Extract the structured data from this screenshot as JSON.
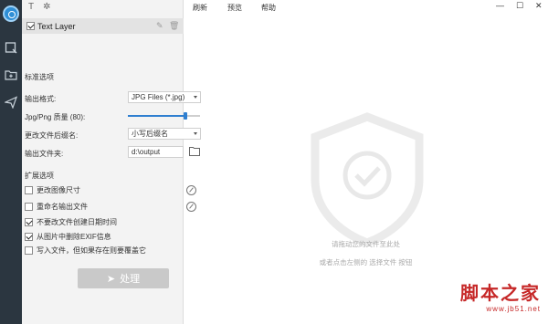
{
  "sidebar": {
    "icons": [
      "app-logo-icon",
      "crop-icon",
      "add-folder-icon",
      "send-icon"
    ]
  },
  "left_panel": {
    "toolbar_icons": [
      "text-tool-icon",
      "settings-icon"
    ],
    "layer": {
      "checked": true,
      "name": "Text Layer"
    },
    "standard_section": "标准选项",
    "output_format_label": "输出格式:",
    "output_format_value": "JPG Files (*.jpg)",
    "quality_label": "Jpg/Png 质量 (80):",
    "quality_value": 80,
    "rename_label": "更改文件后缀名:",
    "rename_value": "小写后缀名",
    "output_folder_label": "输出文件夹:",
    "output_folder_value": "d:\\output",
    "extended_section": "扩展选项",
    "options": [
      {
        "label": "更改图像尺寸",
        "checked": false,
        "has_settings": true
      },
      {
        "label": "重命名输出文件",
        "checked": false,
        "has_settings": true
      },
      {
        "label": "不要改文件创建日期时间",
        "checked": true,
        "has_settings": false
      },
      {
        "label": "从图片中删除EXIF信息",
        "checked": true,
        "has_settings": false
      },
      {
        "label": "写入文件，但如果存在则要覆盖它",
        "checked": false,
        "has_settings": false
      }
    ],
    "process_button": "处理"
  },
  "menu": {
    "refresh": "刷新",
    "preview": "预览",
    "help": "帮助"
  },
  "window_controls": {
    "minimize": "—",
    "maximize": "☐",
    "close": "✕"
  },
  "drop_area": {
    "hint_primary": "请拖动您的文件至此处",
    "hint_secondary": "或者点击左侧的 选择文件 按钮"
  },
  "watermark": {
    "title": "脚本之家",
    "url": "www.jb51.net"
  }
}
